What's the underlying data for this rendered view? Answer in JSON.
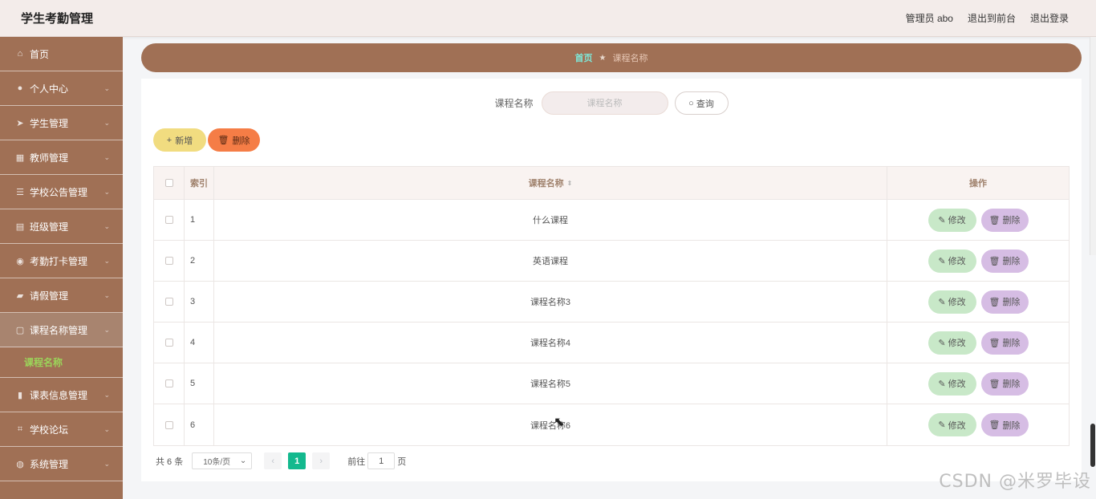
{
  "header": {
    "title": "学生考勤管理",
    "user": "管理员 abo",
    "back_to_front": "退出到前台",
    "logout": "退出登录"
  },
  "sidebar": {
    "items": [
      {
        "label": "首页",
        "icon": "home-icon",
        "glyph": "⌂",
        "has_arrow": false
      },
      {
        "label": "个人中心",
        "icon": "user-icon",
        "glyph": "●",
        "has_arrow": true
      },
      {
        "label": "学生管理",
        "icon": "send-icon",
        "glyph": "➤",
        "has_arrow": true
      },
      {
        "label": "教师管理",
        "icon": "calendar-icon",
        "glyph": "▦",
        "has_arrow": true
      },
      {
        "label": "学校公告管理",
        "icon": "sliders-icon",
        "glyph": "☰",
        "has_arrow": true
      },
      {
        "label": "班级管理",
        "icon": "clipboard-icon",
        "glyph": "▤",
        "has_arrow": true
      },
      {
        "label": "考勤打卡管理",
        "icon": "location-icon",
        "glyph": "◉",
        "has_arrow": true
      },
      {
        "label": "请假管理",
        "icon": "thumb-icon",
        "glyph": "▰",
        "has_arrow": true
      },
      {
        "label": "课程名称管理",
        "icon": "window-icon",
        "glyph": "▢",
        "has_arrow": true,
        "open": true
      },
      {
        "label": "课表信息管理",
        "icon": "chart-icon",
        "glyph": "▮",
        "has_arrow": true
      },
      {
        "label": "学校论坛",
        "icon": "crop-icon",
        "glyph": "⌗",
        "has_arrow": true
      },
      {
        "label": "系统管理",
        "icon": "globe-icon",
        "glyph": "◍",
        "has_arrow": true
      }
    ],
    "sub_item": "课程名称"
  },
  "breadcrumb": {
    "home": "首页",
    "current": "课程名称"
  },
  "search": {
    "label": "课程名称",
    "placeholder": "课程名称",
    "button": "查询"
  },
  "actions": {
    "add": "新增",
    "delete": "删除"
  },
  "table": {
    "headers": {
      "index": "索引",
      "name": "课程名称",
      "op": "操作"
    },
    "rows": [
      {
        "index": "1",
        "name": "什么课程"
      },
      {
        "index": "2",
        "name": "英语课程"
      },
      {
        "index": "3",
        "name": "课程名称3"
      },
      {
        "index": "4",
        "name": "课程名称4"
      },
      {
        "index": "5",
        "name": "课程名称5"
      },
      {
        "index": "6",
        "name": "课程名称6"
      }
    ],
    "edit_label": "修改",
    "delete_label": "删除"
  },
  "pager": {
    "total": "共 6 条",
    "page_size": "10条/页",
    "current_page": "1",
    "goto_prefix": "前往",
    "goto_value": "1",
    "goto_suffix": "页"
  },
  "watermark": "CSDN @米罗毕设",
  "colors": {
    "sidebar": "#a07055",
    "accent_green": "#13b98e",
    "add_button": "#f1dc80",
    "delete_button": "#f57d46"
  }
}
